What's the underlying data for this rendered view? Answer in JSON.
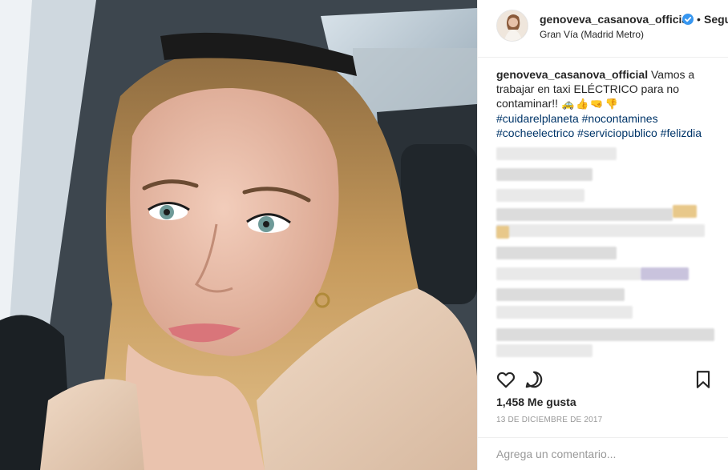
{
  "post": {
    "photo_description": "",
    "header": {
      "username": "genoveva_casanova_official",
      "separator": "•",
      "follow_label": "Segu",
      "location": "Gran Vía (Madrid Metro)"
    },
    "caption": {
      "username": "genoveva_casanova_official",
      "text": "Vamos a trabajar en taxi ELÉCTRICO para no contaminar!!",
      "emojis": "🚕👍🤜👎",
      "hashtags": [
        "#cuidarelplaneta",
        "#nocontamines",
        "#cocheelectrico",
        "#serviciopublico",
        "#felizdia"
      ]
    },
    "actions": {
      "like_icon": "heart-icon",
      "comment_icon": "comment-icon",
      "save_icon": "bookmark-icon"
    },
    "likes": "1,458 Me gusta",
    "date": "13 DE DICIEMBRE DE 2017",
    "comment_placeholder": "Agrega un comentario...",
    "colors": {
      "text": "#262626",
      "hashtag": "#003569",
      "muted": "#999999",
      "verified": "#3897f0",
      "border": "#efefef"
    }
  }
}
